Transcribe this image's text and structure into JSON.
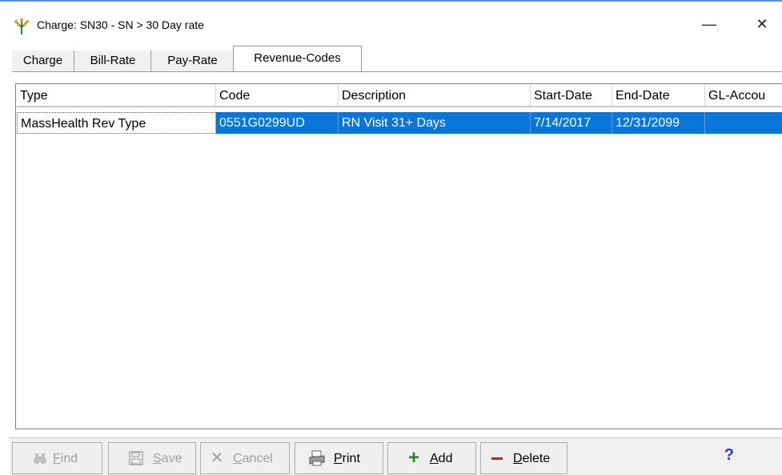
{
  "window": {
    "title": "Charge: SN30 - SN > 30 Day rate",
    "minimize_glyph": "—",
    "close_glyph": "✕"
  },
  "tabs": [
    {
      "label": "Charge",
      "active": false
    },
    {
      "label": "Bill-Rate",
      "active": false
    },
    {
      "label": "Pay-Rate",
      "active": false
    },
    {
      "label": "Revenue-Codes",
      "active": true
    }
  ],
  "grid": {
    "columns": [
      "Type",
      "Code",
      "Description",
      "Start-Date",
      "End-Date",
      "GL-Accou"
    ],
    "rows": [
      {
        "type": "MassHealth Rev Type",
        "code": "0551G0299UD",
        "description": "RN Visit 31+ Days",
        "start_date": "7/14/2017",
        "end_date": "12/31/2099",
        "gl_account": "",
        "selected": true
      }
    ]
  },
  "toolbar": {
    "find": {
      "label_first": "F",
      "label_rest": "ind",
      "enabled": false,
      "icon": "binoculars-icon"
    },
    "save": {
      "label_first": "S",
      "label_rest": "ave",
      "enabled": false,
      "icon": "floppy-icon"
    },
    "cancel": {
      "label_first": "C",
      "label_rest": "ancel",
      "enabled": false,
      "icon": "x-icon"
    },
    "print": {
      "label_first": "P",
      "label_rest": "rint",
      "enabled": true,
      "icon": "printer-icon"
    },
    "add": {
      "label_first": "A",
      "label_rest": "dd",
      "enabled": true,
      "icon": "plus-icon"
    },
    "delete": {
      "label_first": "D",
      "label_rest": "elete",
      "enabled": true,
      "icon": "minus-icon"
    },
    "help": {
      "glyph": "?",
      "icon": "help-icon"
    }
  },
  "colors": {
    "selection": "#0a76d8",
    "plus": "#1f8a1f",
    "minus": "#d02020",
    "help": "#1b3fcf"
  }
}
